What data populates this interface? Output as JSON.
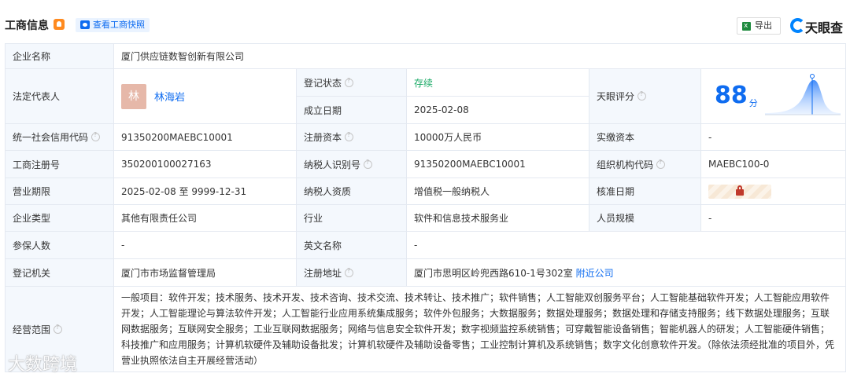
{
  "header": {
    "title": "工商信息",
    "snapshot_label": "查看工商快照",
    "export_label": "导出",
    "logo_text": "天眼查"
  },
  "company": {
    "name_label": "企业名称",
    "name": "厦门供应链数智创新有限公司",
    "rep_label": "法定代表人",
    "rep_avatar": "林",
    "rep_name": "林海岩",
    "status_label": "登记状态",
    "status": "存续",
    "founded_label": "成立日期",
    "founded": "2025-02-08",
    "score_label": "天眼评分",
    "score": "88",
    "score_unit": "分",
    "credit_label": "统一社会信用代码",
    "credit": "91350200MAEBC10001",
    "capital_label": "注册资本",
    "capital": "10000万人民币",
    "paid_label": "实缴资本",
    "paid": "-",
    "reg_no_label": "工商注册号",
    "reg_no": "350200100027163",
    "tax_id_label": "纳税人识别号",
    "tax_id": "91350200MAEBC10001",
    "org_code_label": "组织机构代码",
    "org_code": "MAEBC100-0",
    "term_label": "营业期限",
    "term": "2025-02-08 至 9999-12-31",
    "tax_qual_label": "纳税人资质",
    "tax_qual": "增值税一般纳税人",
    "approve_label": "核准日期",
    "type_label": "企业类型",
    "type": "其他有限责任公司",
    "industry_label": "行业",
    "industry": "软件和信息技术服务业",
    "staff_label": "人员规模",
    "staff": "-",
    "insured_label": "参保人数",
    "insured": "-",
    "en_name_label": "英文名称",
    "en_name": "-",
    "authority_label": "登记机关",
    "authority": "厦门市市场监督管理局",
    "address_label": "注册地址",
    "address": "厦门市思明区岭兜西路610-1号302室",
    "nearby_label": "附近公司",
    "scope_label": "经营范围",
    "scope": "一般项目：软件开发；技术服务、技术开发、技术咨询、技术交流、技术转让、技术推广；软件销售；人工智能双创服务平台；人工智能基础软件开发；人工智能应用软件开发；人工智能理论与算法软件开发；人工智能行业应用系统集成服务；软件外包服务；大数据服务；数据处理服务；数据处理和存储支持服务；线下数据处理服务；互联网数据服务；互联网安全服务；工业互联网数据服务；网络与信息安全软件开发；数字视频监控系统销售；可穿戴智能设备销售；智能机器人的研发；人工智能硬件销售；科技推广和应用服务；计算机软硬件及辅助设备批发；计算机软硬件及辅助设备零售；工业控制计算机及系统销售；数字文化创意软件开发。（除依法须经批准的项目外，凭营业执照依法自主开展经营活动）"
  },
  "watermark": "大数跨境",
  "colors": {
    "accent": "#0f6cf0",
    "label_bg": "#f4f8fd",
    "status_green": "#1aaa66"
  }
}
